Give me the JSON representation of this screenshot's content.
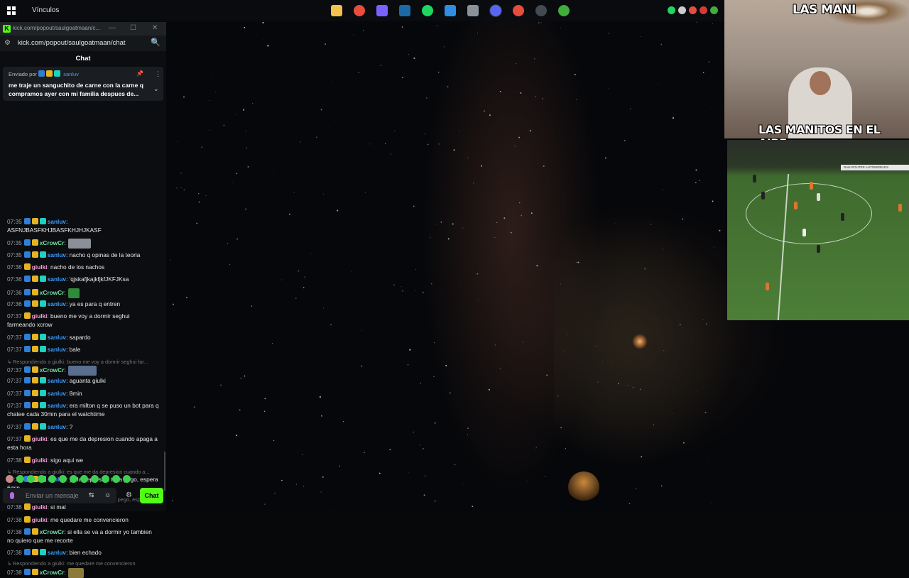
{
  "taskbar": {
    "links_label": "Vínculos",
    "apps": [
      {
        "icon": "file-explorer-icon",
        "color": "#f2c14e"
      },
      {
        "icon": "chrome-icon",
        "color": "#e84c3d"
      },
      {
        "icon": "copilot-icon",
        "color": "#7b61ff"
      },
      {
        "icon": "steam-icon",
        "color": "#1b6aa5"
      },
      {
        "icon": "spotify-icon",
        "color": "#1ed760"
      },
      {
        "icon": "ms-store-icon",
        "color": "#2f8de4"
      },
      {
        "icon": "pc-icon",
        "color": "#8a9199"
      },
      {
        "icon": "discord-icon",
        "color": "#5865f2"
      },
      {
        "icon": "chrome-profile-icon",
        "color": "#e84c3d"
      },
      {
        "icon": "obs-icon",
        "color": "#444a52"
      },
      {
        "icon": "xbox-icon",
        "color": "#3fae3a"
      }
    ],
    "tray": [
      {
        "icon": "spotify-tray-icon",
        "color": "#1ed760"
      },
      {
        "icon": "discord-tray-icon",
        "color": "#cccccc"
      },
      {
        "icon": "app-tray-icon",
        "color": "#e84c3d"
      },
      {
        "icon": "app-tray-icon-2",
        "color": "#d33a3a"
      },
      {
        "icon": "xbox-tray-icon",
        "color": "#3fae3a"
      }
    ]
  },
  "chat_window": {
    "title": "kick.com/popout/saulgoatmaan/c...",
    "url": "kick.com/popout/saulgoatmaan/chat",
    "header": "Chat",
    "pinned": {
      "by_label": "Enviado por",
      "user": "sanluv",
      "text": "me traje un sanguchito de carne con la carne q compramos ayer con mi familia despues de..."
    },
    "messages": [
      {
        "time": "07:35",
        "user": "sanluv",
        "text": ": ASFNJBASFKHJBASFKHJHJKASF"
      },
      {
        "time": "07:35",
        "user": "xCrowCr",
        "text": ":"
      },
      {
        "time": "07:35",
        "user": "sanluv",
        "text": ": nacho q opinas de la teoria"
      },
      {
        "time": "07:36",
        "user": "giulki",
        "text": ": nacho de los nachos"
      },
      {
        "time": "07:36",
        "user": "sanluv",
        "text": ": 'qjskafjkajkfjkfJKFJKsa"
      },
      {
        "time": "07:36",
        "user": "xCrowCr",
        "text": ":"
      },
      {
        "time": "07:36",
        "user": "sanluv",
        "text": ": ya es para q entren"
      },
      {
        "time": "07:37",
        "user": "giulki",
        "text": ": bueno me voy a dormir seghui farmeando xcrow"
      },
      {
        "time": "07:37",
        "user": "sanluv",
        "text": ": sapardo"
      },
      {
        "time": "07:37",
        "user": "sanluv",
        "text": ": bale"
      },
      {
        "reply": "Respondiendo a giulki: bueno me voy a dormir seghui far..."
      },
      {
        "time": "07:37",
        "user": "xCrowCr",
        "text": ":"
      },
      {
        "time": "07:37",
        "user": "sanluv",
        "text": ": aguanta giulki"
      },
      {
        "time": "07:37",
        "user": "sanluv",
        "text": ": 8min"
      },
      {
        "time": "07:37",
        "user": "sanluv",
        "text": ": era milton q se puso un bot para q chatee cada 30min para el watchtime"
      },
      {
        "time": "07:37",
        "user": "sanluv",
        "text": ": ?"
      },
      {
        "time": "07:37",
        "user": "giulki",
        "text": ": es que me da depresion cuando apaga a esta hora"
      },
      {
        "time": "07:38",
        "user": "giulki",
        "text": ": sigo aqui we"
      },
      {
        "reply": "Respondiendo a giulki: es que me da depresion cuando a..."
      },
      {
        "time": "07:38",
        "user": "sanluv",
        "text": ": ya la depresion te la pego, espera 6min"
      },
      {
        "reply": "Respondiendo a sanluv: ya la depresion te la pego, esper..."
      },
      {
        "time": "07:38",
        "user": "giulki",
        "text": ": si mal"
      },
      {
        "time": "07:38",
        "user": "giulki",
        "text": ": me quedare me convencieron"
      },
      {
        "time": "07:38",
        "user": "xCrowCr",
        "text": ": si ella se va a dormir yo tambien no quiero que me recorte"
      },
      {
        "time": "07:38",
        "user": "sanluv",
        "text": ": bien echado"
      },
      {
        "reply": "Respondiendo a giulki: me quedare me convencieron"
      },
      {
        "time": "07:38",
        "user": "xCrowCr",
        "text": ":"
      }
    ],
    "input_placeholder": "Enviar un mensaje",
    "send_label": "Chat"
  },
  "overlay": {
    "top_caption": "LAS MANI",
    "bottom_caption": "LAS MANITOS EN EL AIRE",
    "ad_text": "RAN ROUTER AUTOMOBILES"
  },
  "colors": {
    "kick_green": "#53fc18",
    "sanluv": "#3b9dff",
    "xcrow": "#6fe0a4",
    "giulki": "#f2a0d8"
  }
}
